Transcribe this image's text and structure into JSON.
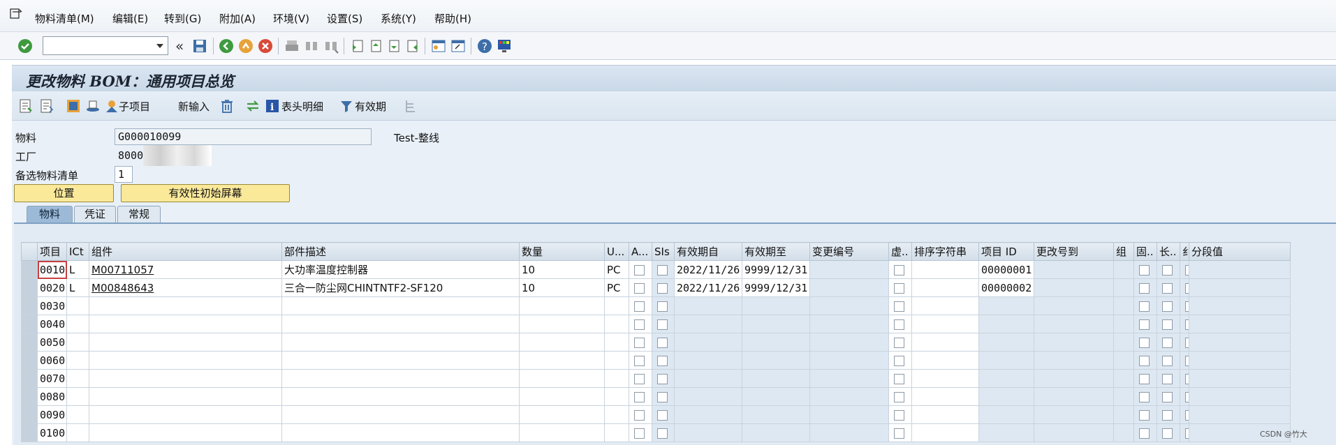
{
  "menubar": {
    "items": [
      "物料清单(M)",
      "编辑(E)",
      "转到(G)",
      "附加(A)",
      "环境(V)",
      "设置(S)",
      "系统(Y)",
      "帮助(H)"
    ]
  },
  "systoolbar": {
    "command_value": "",
    "icons": [
      "enter-icon",
      "back-double-icon",
      "save-icon",
      "back-icon",
      "exit-icon",
      "cancel-icon",
      "print-icon",
      "find-icon",
      "find-next-icon",
      "first-page-icon",
      "prev-page-icon",
      "next-page-icon",
      "last-page-icon",
      "new-session-icon",
      "shortcut-icon",
      "help-icon",
      "customize-layout-icon"
    ]
  },
  "title": "更改物料 BOM：通用项目总览",
  "apptoolbar": {
    "subitem_label": "子项目",
    "new_entry_label": "新输入",
    "header_detail_label": "表头明细",
    "validity_label": "有效期"
  },
  "header": {
    "material_label": "物料",
    "material_value": "G000010099",
    "material_desc": "Test-整线",
    "plant_label": "工厂",
    "plant_value": "8000",
    "alt_bom_label": "备选物料清单",
    "alt_bom_value": "1",
    "position_button": "位置",
    "validity_button": "有效性初始屏幕"
  },
  "tabs": [
    "物料",
    "凭证",
    "常规"
  ],
  "grid": {
    "columns": [
      "项目",
      "ICt",
      "组件",
      "部件描述",
      "数量",
      "U...",
      "A...",
      "SIs",
      "有效期自",
      "有效期至",
      "变更编号",
      "虚..",
      "排序字符串",
      "项目 ID",
      "更改号到",
      "组",
      "固..",
      "长..",
      "纟",
      "分段值"
    ],
    "rows": [
      {
        "item": "0010",
        "ict": "L",
        "component": "M00711057",
        "desc": "大功率温度控制器",
        "qty": "10",
        "unit": "PC",
        "valid_from": "2022/11/26",
        "valid_to": "9999/12/31",
        "item_id": "00000001"
      },
      {
        "item": "0020",
        "ict": "L",
        "component": "M00848643",
        "desc": "三合一防尘网CHINTNTF2-SF120",
        "qty": "10",
        "unit": "PC",
        "valid_from": "2022/11/26",
        "valid_to": "9999/12/31",
        "item_id": "00000002"
      },
      {
        "item": "0030",
        "ict": "",
        "component": "",
        "desc": "",
        "qty": "",
        "unit": "",
        "valid_from": "",
        "valid_to": "",
        "item_id": ""
      },
      {
        "item": "0040",
        "ict": "",
        "component": "",
        "desc": "",
        "qty": "",
        "unit": "",
        "valid_from": "",
        "valid_to": "",
        "item_id": ""
      },
      {
        "item": "0050",
        "ict": "",
        "component": "",
        "desc": "",
        "qty": "",
        "unit": "",
        "valid_from": "",
        "valid_to": "",
        "item_id": ""
      },
      {
        "item": "0060",
        "ict": "",
        "component": "",
        "desc": "",
        "qty": "",
        "unit": "",
        "valid_from": "",
        "valid_to": "",
        "item_id": ""
      },
      {
        "item": "0070",
        "ict": "",
        "component": "",
        "desc": "",
        "qty": "",
        "unit": "",
        "valid_from": "",
        "valid_to": "",
        "item_id": ""
      },
      {
        "item": "0080",
        "ict": "",
        "component": "",
        "desc": "",
        "qty": "",
        "unit": "",
        "valid_from": "",
        "valid_to": "",
        "item_id": ""
      },
      {
        "item": "0090",
        "ict": "",
        "component": "",
        "desc": "",
        "qty": "",
        "unit": "",
        "valid_from": "",
        "valid_to": "",
        "item_id": ""
      },
      {
        "item": "0100",
        "ict": "",
        "component": "",
        "desc": "",
        "qty": "",
        "unit": "",
        "valid_from": "",
        "valid_to": "",
        "item_id": ""
      }
    ]
  },
  "watermark": "CSDN @竹大",
  "colors": {
    "title_bg": "#c9d8e8",
    "grid_header": "#d3dee9",
    "readonly_cell": "#dde8f2",
    "button_yellow": "#fbe99a",
    "tab_active": "#9cbad8"
  }
}
